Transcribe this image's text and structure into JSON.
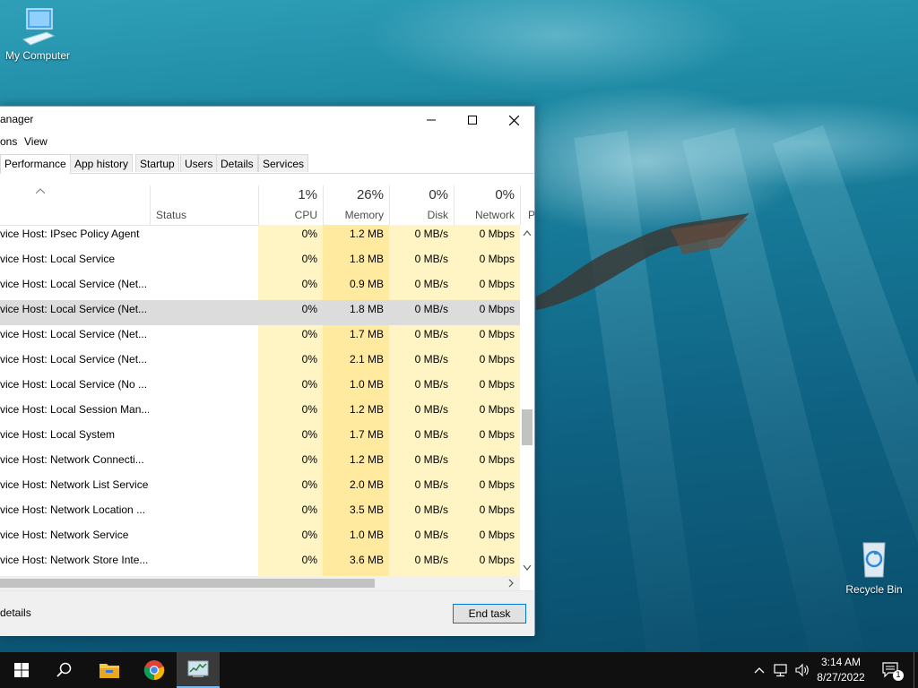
{
  "desktop": {
    "icons": [
      {
        "label": "My Computer",
        "icon": "computer-icon"
      },
      {
        "label": "Recycle Bin",
        "icon": "recycle-bin-icon"
      }
    ]
  },
  "window": {
    "title": "anager",
    "menu": [
      "ons",
      "View"
    ],
    "tabs": [
      "Performance",
      "App history",
      "Startup",
      "Users",
      "Details",
      "Services"
    ],
    "active_tab": "Performance",
    "columns": {
      "status": "Status",
      "cpu": {
        "pct": "1%",
        "label": "CPU"
      },
      "memory": {
        "pct": "26%",
        "label": "Memory"
      },
      "disk": {
        "pct": "0%",
        "label": "Disk"
      },
      "network": {
        "pct": "0%",
        "label": "Network"
      },
      "power_partial": "P"
    },
    "rows": [
      {
        "name": "vice Host: IPsec Policy Agent",
        "cpu": "0%",
        "mem": "1.2 MB",
        "disk": "0 MB/s",
        "net": "0 Mbps"
      },
      {
        "name": "vice Host: Local Service",
        "cpu": "0%",
        "mem": "1.8 MB",
        "disk": "0 MB/s",
        "net": "0 Mbps"
      },
      {
        "name": "vice Host: Local Service (Net...",
        "cpu": "0%",
        "mem": "0.9 MB",
        "disk": "0 MB/s",
        "net": "0 Mbps"
      },
      {
        "name": "vice Host: Local Service (Net...",
        "cpu": "0%",
        "mem": "1.8 MB",
        "disk": "0 MB/s",
        "net": "0 Mbps"
      },
      {
        "name": "vice Host: Local Service (Net...",
        "cpu": "0%",
        "mem": "1.7 MB",
        "disk": "0 MB/s",
        "net": "0 Mbps"
      },
      {
        "name": "vice Host: Local Service (Net...",
        "cpu": "0%",
        "mem": "2.1 MB",
        "disk": "0 MB/s",
        "net": "0 Mbps"
      },
      {
        "name": "vice Host: Local Service (No ...",
        "cpu": "0%",
        "mem": "1.0 MB",
        "disk": "0 MB/s",
        "net": "0 Mbps"
      },
      {
        "name": "vice Host: Local Session Man...",
        "cpu": "0%",
        "mem": "1.2 MB",
        "disk": "0 MB/s",
        "net": "0 Mbps"
      },
      {
        "name": "vice Host: Local System",
        "cpu": "0%",
        "mem": "1.7 MB",
        "disk": "0 MB/s",
        "net": "0 Mbps"
      },
      {
        "name": "vice Host: Network Connecti...",
        "cpu": "0%",
        "mem": "1.2 MB",
        "disk": "0 MB/s",
        "net": "0 Mbps"
      },
      {
        "name": "vice Host: Network List Service",
        "cpu": "0%",
        "mem": "2.0 MB",
        "disk": "0 MB/s",
        "net": "0 Mbps"
      },
      {
        "name": "vice Host: Network Location ...",
        "cpu": "0%",
        "mem": "3.5 MB",
        "disk": "0 MB/s",
        "net": "0 Mbps"
      },
      {
        "name": "vice Host: Network Service",
        "cpu": "0%",
        "mem": "1.0 MB",
        "disk": "0 MB/s",
        "net": "0 Mbps"
      },
      {
        "name": "vice Host: Network Store Inte...",
        "cpu": "0%",
        "mem": "3.6 MB",
        "disk": "0 MB/s",
        "net": "0 Mbps"
      }
    ],
    "selected_row": 3,
    "footer": {
      "details": "details",
      "end_task": "End task"
    }
  },
  "taskbar": {
    "items": [
      "start-icon",
      "search-icon",
      "file-explorer-icon",
      "chrome-icon",
      "task-manager-icon"
    ],
    "clock": {
      "time": "3:14 AM",
      "date": "8/27/2022"
    },
    "notification_count": "1"
  },
  "colors": {
    "heat_light": "#fff4c4",
    "heat_medium": "#ffeaa0",
    "selected_row": "#dcdcdc",
    "accent": "#0078d7"
  }
}
